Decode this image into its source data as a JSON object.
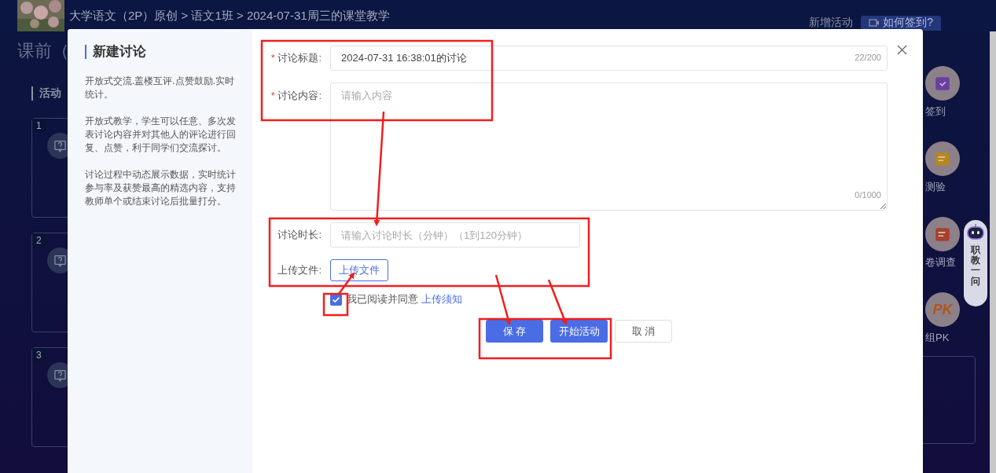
{
  "header": {
    "breadcrumb": "大学语文（2P）原创 > 语文1班 > 2024-07-31周三的课堂教学",
    "add_activity": "新增活动",
    "how_to_checkin": "如何签到?"
  },
  "section_title": "课前（",
  "activity_list_title": "活动",
  "activity_cards": [
    {
      "number": "1"
    },
    {
      "number": "2"
    },
    {
      "number": "3"
    }
  ],
  "activity_types": [
    {
      "label": "签到",
      "kind": "checkin"
    },
    {
      "label": "测验",
      "kind": "quiz"
    },
    {
      "label": "卷调查",
      "kind": "survey"
    },
    {
      "label": "组PK",
      "kind": "pk",
      "icon_text": "PK"
    }
  ],
  "assistant": {
    "label": "职教一问"
  },
  "dialog": {
    "title": "新建讨论",
    "descriptions": [
      "开放式交流.盖楼互评.点赞鼓励.实时统计。",
      "开放式教学，学生可以任意、多次发表讨论内容并对其他人的评论进行回复、点赞，利于同学们交流探讨。",
      "讨论过程中动态展示数据，实时统计参与率及获赞最高的精选内容，支持教师单个或结束讨论后批量打分。"
    ],
    "title_field": {
      "required_mark": "*",
      "label": "讨论标题:",
      "value": "2024-07-31 16:38:01的讨论",
      "counter": "22/200"
    },
    "content_field": {
      "required_mark": "*",
      "label": "讨论内容:",
      "placeholder": "请输入内容",
      "counter": "0/1000"
    },
    "duration_field": {
      "label": "讨论时长:",
      "placeholder": "请输入讨论时长（分钟）（1到120分钟）"
    },
    "upload_field": {
      "label": "上传文件:",
      "button": "上传文件"
    },
    "agreement": {
      "checked": true,
      "text": "我已阅读并同意",
      "link": "上传须知"
    },
    "buttons": [
      {
        "label": "保 存",
        "kind": "primary"
      },
      {
        "label": "开始活动",
        "kind": "primary"
      },
      {
        "label": "取 消",
        "kind": "default"
      }
    ]
  }
}
